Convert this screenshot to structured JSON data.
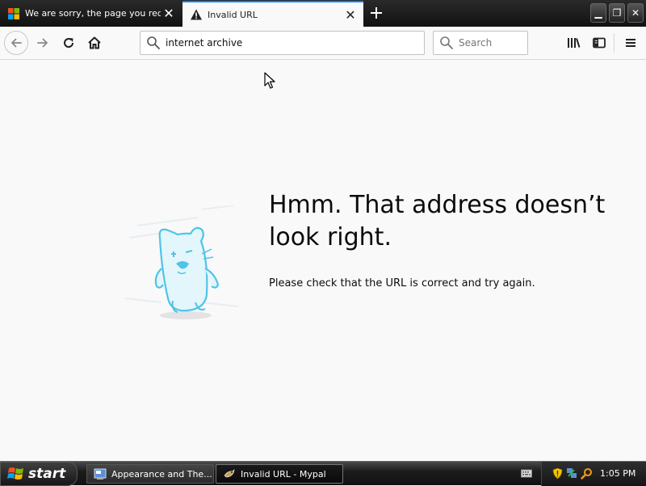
{
  "tabs": [
    {
      "title": "We are sorry, the page you reque",
      "close": "✕",
      "active": false
    },
    {
      "title": "Invalid URL",
      "close": "✕",
      "active": true
    }
  ],
  "window": {
    "minimize": "▁",
    "maximize": "❐",
    "close": "✕"
  },
  "toolbar": {
    "url_value": "internet archive",
    "search_placeholder": "Search"
  },
  "error": {
    "title": "Hmm. That address doesn’t look right.",
    "description": "Please check that the URL is correct and try again."
  },
  "taskbar": {
    "start_label": "start",
    "tasks": [
      {
        "label": "Appearance and The...",
        "active": false
      },
      {
        "label": "Invalid URL - Mypal",
        "active": true
      }
    ],
    "clock": "1:05 PM"
  },
  "colors": {
    "accent": "#0a84ff",
    "page_bg": "#f9f9fa",
    "illustration": "#4fc3e8"
  },
  "icons": [
    "windows-logo-icon",
    "warning-icon",
    "back-icon",
    "forward-icon",
    "reload-icon",
    "home-icon",
    "search-icon",
    "library-icon",
    "sidebar-icon",
    "menu-icon"
  ]
}
